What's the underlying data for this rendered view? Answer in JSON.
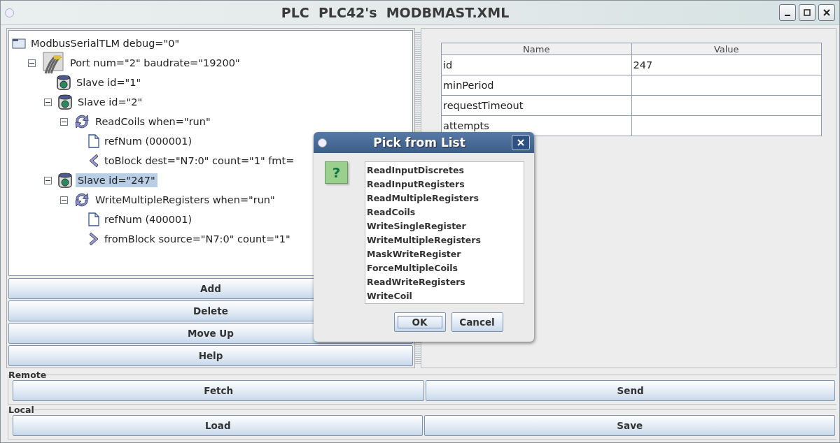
{
  "window": {
    "title": "PLC  PLC42's  MODBMAST.XML"
  },
  "tree": [
    {
      "label": "ModbusSerialTLM debug=\"0\"",
      "kind": "folder",
      "selected": false,
      "children": [
        {
          "label": "Port num=\"2\" baudrate=\"19200\"",
          "kind": "port",
          "selected": false,
          "expanded": true,
          "children": [
            {
              "label": "Slave id=\"1\"",
              "kind": "slave",
              "selected": false
            },
            {
              "label": "Slave id=\"2\"",
              "kind": "slave",
              "selected": false,
              "expanded": true,
              "children": [
                {
                  "label": "ReadCoils when=\"run\"",
                  "kind": "poll",
                  "selected": false,
                  "expanded": true,
                  "children": [
                    {
                      "label": "refNum (000001)",
                      "kind": "ref",
                      "selected": false
                    },
                    {
                      "label": "toBlock dest=\"N7:0\" count=\"1\" fmt=",
                      "kind": "to-block",
                      "selected": false
                    }
                  ]
                }
              ]
            },
            {
              "label": "Slave id=\"247\"",
              "kind": "slave",
              "selected": true,
              "expanded": true,
              "children": [
                {
                  "label": "WriteMultipleRegisters when=\"run\"",
                  "kind": "poll",
                  "selected": false,
                  "expanded": true,
                  "children": [
                    {
                      "label": "refNum (400001)",
                      "kind": "ref",
                      "selected": false
                    },
                    {
                      "label": "fromBlock source=\"N7:0\" count=\"1\"",
                      "kind": "from-block",
                      "selected": false
                    }
                  ]
                }
              ]
            }
          ]
        }
      ]
    }
  ],
  "tree_buttons": [
    "Add",
    "Delete",
    "Move Up",
    "Help"
  ],
  "table": {
    "columns": [
      "Name",
      "Value"
    ],
    "rows": [
      {
        "name": "id",
        "value": "247"
      },
      {
        "name": "minPeriod"
      },
      {
        "name": "requestTimeout"
      },
      {
        "name": "attempts"
      }
    ]
  },
  "groups": [
    {
      "title": "Remote",
      "buttons": [
        "Fetch",
        "Send"
      ]
    },
    {
      "title": "Local",
      "buttons": [
        "Load",
        "Save"
      ]
    }
  ],
  "dialog": {
    "title": "Pick from List",
    "icon_glyph": "?",
    "items": [
      {
        "label": "ReadInputDiscretes",
        "selected": false
      },
      {
        "label": "ReadInputRegisters",
        "selected": false
      },
      {
        "label": "ReadMultipleRegisters",
        "selected": false
      },
      {
        "label": "ReadCoils",
        "selected": false
      },
      {
        "label": "WriteSingleRegister",
        "selected": false
      },
      {
        "label": "WriteMultipleRegisters",
        "selected": false
      },
      {
        "label": "MaskWriteRegister",
        "selected": false
      },
      {
        "label": "ForceMultipleCoils",
        "selected": false
      },
      {
        "label": "ReadWriteRegisters",
        "selected": false
      },
      {
        "label": "WriteCoil",
        "selected": false
      }
    ],
    "buttons": [
      {
        "label": "OK",
        "focused": true
      },
      {
        "label": "Cancel",
        "focused": false
      }
    ]
  }
}
